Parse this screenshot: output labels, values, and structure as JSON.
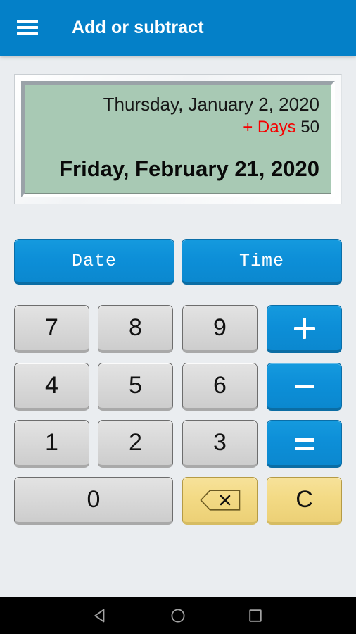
{
  "appbar": {
    "title": "Add or subtract",
    "menu_icon": "hamburger-menu-icon",
    "background_color": "#0480c8"
  },
  "display": {
    "screen_color": "#a8c9b4",
    "start_date": "Thursday, January 2, 2020",
    "operation_label": "+ Days",
    "operation_color": "#f60000",
    "operation_value": "50",
    "result_date": "Friday, February 21, 2020"
  },
  "mode_buttons": [
    {
      "label": "Date",
      "name": "date-mode-button"
    },
    {
      "label": "Time",
      "name": "time-mode-button"
    }
  ],
  "keypad": {
    "row1": [
      {
        "label": "7",
        "name": "key-7"
      },
      {
        "label": "8",
        "name": "key-8"
      },
      {
        "label": "9",
        "name": "key-9"
      },
      {
        "label": "+",
        "name": "key-plus"
      }
    ],
    "row2": [
      {
        "label": "4",
        "name": "key-4"
      },
      {
        "label": "5",
        "name": "key-5"
      },
      {
        "label": "6",
        "name": "key-6"
      },
      {
        "label": "−",
        "name": "key-minus"
      }
    ],
    "row3": [
      {
        "label": "1",
        "name": "key-1"
      },
      {
        "label": "2",
        "name": "key-2"
      },
      {
        "label": "3",
        "name": "key-3"
      },
      {
        "label": "=",
        "name": "key-equals"
      }
    ],
    "row4": [
      {
        "label": "0",
        "name": "key-0"
      },
      {
        "label": "",
        "name": "key-backspace",
        "icon": "backspace-icon"
      },
      {
        "label": "C",
        "name": "key-clear"
      }
    ]
  },
  "colors": {
    "page_background": "#eaedf0",
    "accent_blue": "#0d8fd8",
    "number_key": "#dadada",
    "action_key": "#f3da85"
  },
  "navbar": {
    "back": "back-triangle-icon",
    "home": "home-circle-icon",
    "recents": "recents-square-icon"
  }
}
